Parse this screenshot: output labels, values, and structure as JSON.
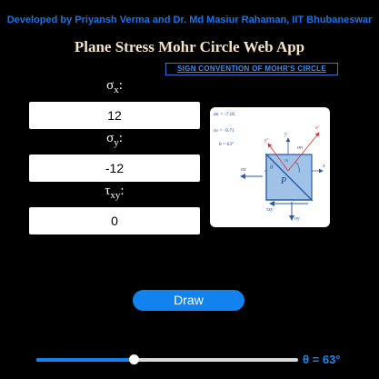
{
  "header": {
    "credit": "Developed by Priyansh Verma and Dr. Md Masiur Rahaman, IIT Bhubaneswar",
    "title": "Plane Stress Mohr Circle Web App",
    "sign_convention_link": "SIGN CONVENTION OF MOHR'S CIRCLE"
  },
  "inputs": {
    "sigma_x": {
      "symbol": "σ",
      "sub": "x",
      "colon": ":",
      "value": "12"
    },
    "sigma_y": {
      "symbol": "σ",
      "sub": "y",
      "colon": ":",
      "value": "-12"
    },
    "tau_xy": {
      "symbol": "τ",
      "sub": "xy",
      "colon": ":",
      "value": "0"
    }
  },
  "diagram": {
    "sigma_n_label": "σn = -7.05",
    "tau_n_label": "τn = -9.71",
    "theta_label": "θ = 63°",
    "point_label": "P",
    "axis_x": "x",
    "axis_y": "y",
    "axis_x_prime": "x'",
    "axis_y_prime": "y'",
    "sig_n": "σn",
    "tau_n": "τn",
    "sig_x": "σx",
    "sig_y": "σy",
    "tau_xy": "τxy",
    "theta_sym": "θ"
  },
  "actions": {
    "draw_label": "Draw"
  },
  "slider": {
    "value_fraction": 0.37,
    "readout": "θ = 63°"
  },
  "colors": {
    "accent": "#1283ee",
    "credit": "#1a73e8",
    "title": "#f3e3c8"
  }
}
